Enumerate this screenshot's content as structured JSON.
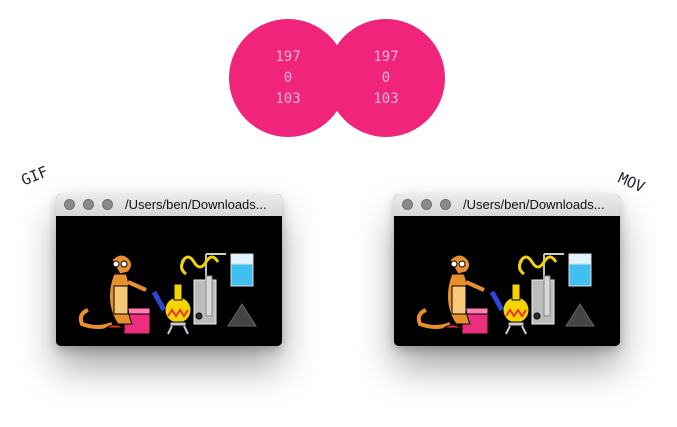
{
  "colors": {
    "circle_fill": "#f0247a",
    "circle_text": "#f8b6d0",
    "labels": "#1f2436"
  },
  "circles": {
    "left": {
      "values": [
        "197",
        "0",
        "103"
      ]
    },
    "right": {
      "values": [
        "197",
        "0",
        "103"
      ]
    }
  },
  "labels": {
    "gif": "GIF",
    "mov": "MOV"
  },
  "windows": {
    "gif": {
      "title": "/Users/ben/Downloads..."
    },
    "mov": {
      "title": "/Users/ben/Downloads..."
    }
  }
}
